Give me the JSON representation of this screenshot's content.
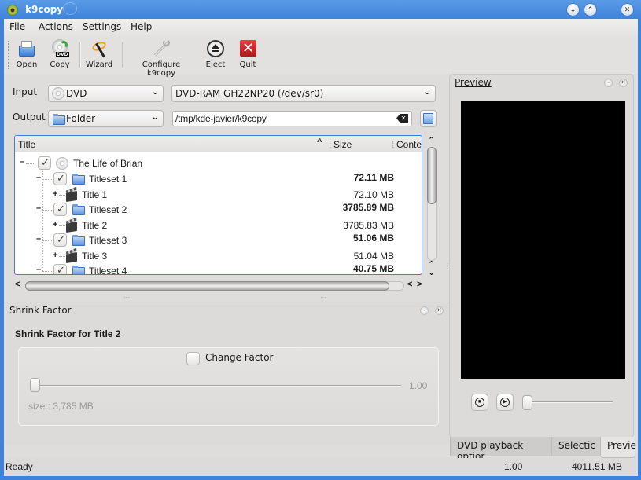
{
  "window": {
    "title": "k9copy"
  },
  "titlebar_buttons": [
    {
      "name": "minimize",
      "glyph": "⌄"
    },
    {
      "name": "maximize",
      "glyph": "⌃"
    },
    {
      "name": "close",
      "glyph": "✕"
    }
  ],
  "menu": [
    {
      "label": "File",
      "mnemonic": "F",
      "rest": "ile"
    },
    {
      "label": "Actions",
      "mnemonic": "A",
      "rest": "ctions",
      "prefix": ""
    },
    {
      "label": "Settings",
      "mnemonic": "S",
      "rest": "ettings"
    },
    {
      "label": "Help",
      "mnemonic": "H",
      "rest": "elp"
    }
  ],
  "toolbar": {
    "open": "Open",
    "copy": "Copy",
    "wizard": "Wizard",
    "configure": "Configure k9copy",
    "eject": "Eject",
    "quit": "Quit",
    "copy_badge": "DVD"
  },
  "source": {
    "input_label": "Input",
    "input_type": "DVD",
    "input_device": "DVD-RAM GH22NP20  (/dev/sr0)",
    "output_label": "Output",
    "output_type": "Folder",
    "output_path": "/tmp/kde-javier/k9copy"
  },
  "tree": {
    "columns": [
      "Title",
      "Size",
      "Conte"
    ],
    "sort_indicator": "^",
    "root": {
      "label": "The Life of Brian",
      "checked": true
    },
    "rows": [
      {
        "type": "titleset",
        "label": "Titleset 1",
        "size": "72.11 MB",
        "checked": true
      },
      {
        "type": "title",
        "label": "Title 1",
        "size": "72.10 MB"
      },
      {
        "type": "titleset",
        "label": "Titleset 2",
        "size": "3785.89 MB",
        "checked": true
      },
      {
        "type": "title",
        "label": "Title 2",
        "size": "3785.83 MB"
      },
      {
        "type": "titleset",
        "label": "Titleset 3",
        "size": "51.06 MB",
        "checked": true
      },
      {
        "type": "title",
        "label": "Title 3",
        "size": "51.04 MB"
      },
      {
        "type": "titleset",
        "label": "Titleset 4",
        "size": "40.75 MB",
        "checked": true
      }
    ]
  },
  "shrink": {
    "dock_title": "Shrink Factor",
    "heading": "Shrink Factor for Title 2",
    "change_factor_label": "Change Factor",
    "change_factor_checked": false,
    "factor_value": "1.00",
    "slider_position": 0,
    "size_text": "size : 3,785 MB"
  },
  "preview": {
    "dock_title": "Preview",
    "seek_position": 0
  },
  "tabs": [
    {
      "label": "DVD playback optior",
      "active": false
    },
    {
      "label": "Selectic",
      "active": false
    },
    {
      "label": "Previe",
      "active": true
    }
  ],
  "status": {
    "message": "Ready",
    "factor": "1.00",
    "total_size": "4011.51 MB"
  }
}
